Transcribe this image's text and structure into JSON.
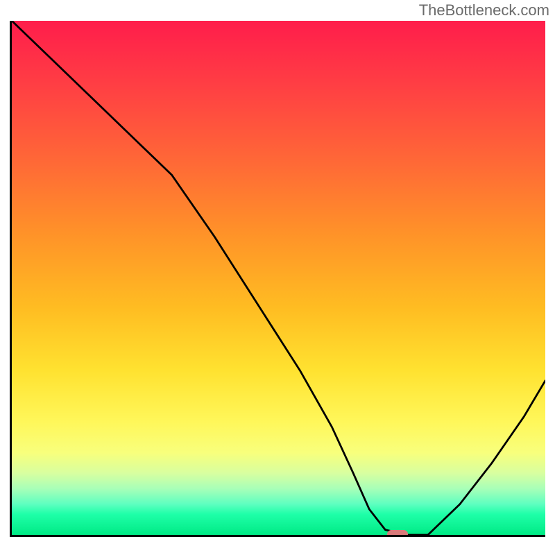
{
  "watermark": "TheBottleneck.com",
  "chart_data": {
    "type": "line",
    "title": "",
    "xlabel": "",
    "ylabel": "",
    "xlim": [
      0,
      100
    ],
    "ylim": [
      0,
      100
    ],
    "series": [
      {
        "name": "bottleneck-curve",
        "x": [
          0,
          8,
          16,
          24,
          30,
          38,
          46,
          54,
          60,
          64,
          67,
          70,
          74,
          78,
          84,
          90,
          96,
          100
        ],
        "y": [
          100,
          92,
          84,
          76,
          70,
          58,
          45,
          32,
          21,
          12,
          5,
          1,
          0,
          0,
          6,
          14,
          23,
          30
        ]
      }
    ],
    "marker": {
      "x": 72,
      "y": 0,
      "color": "#d97a7a"
    },
    "gradient_stops": [
      {
        "pct": 0,
        "color": "#ff1d4b"
      },
      {
        "pct": 12,
        "color": "#ff3d44"
      },
      {
        "pct": 28,
        "color": "#ff6a36"
      },
      {
        "pct": 42,
        "color": "#ff9428"
      },
      {
        "pct": 56,
        "color": "#ffbd22"
      },
      {
        "pct": 68,
        "color": "#ffe230"
      },
      {
        "pct": 78,
        "color": "#fff75a"
      },
      {
        "pct": 84,
        "color": "#f8ff7c"
      },
      {
        "pct": 88,
        "color": "#d8ffa0"
      },
      {
        "pct": 91,
        "color": "#a8ffb8"
      },
      {
        "pct": 94,
        "color": "#5effc0"
      },
      {
        "pct": 96,
        "color": "#1effa8"
      },
      {
        "pct": 100,
        "color": "#00ea85"
      }
    ]
  }
}
